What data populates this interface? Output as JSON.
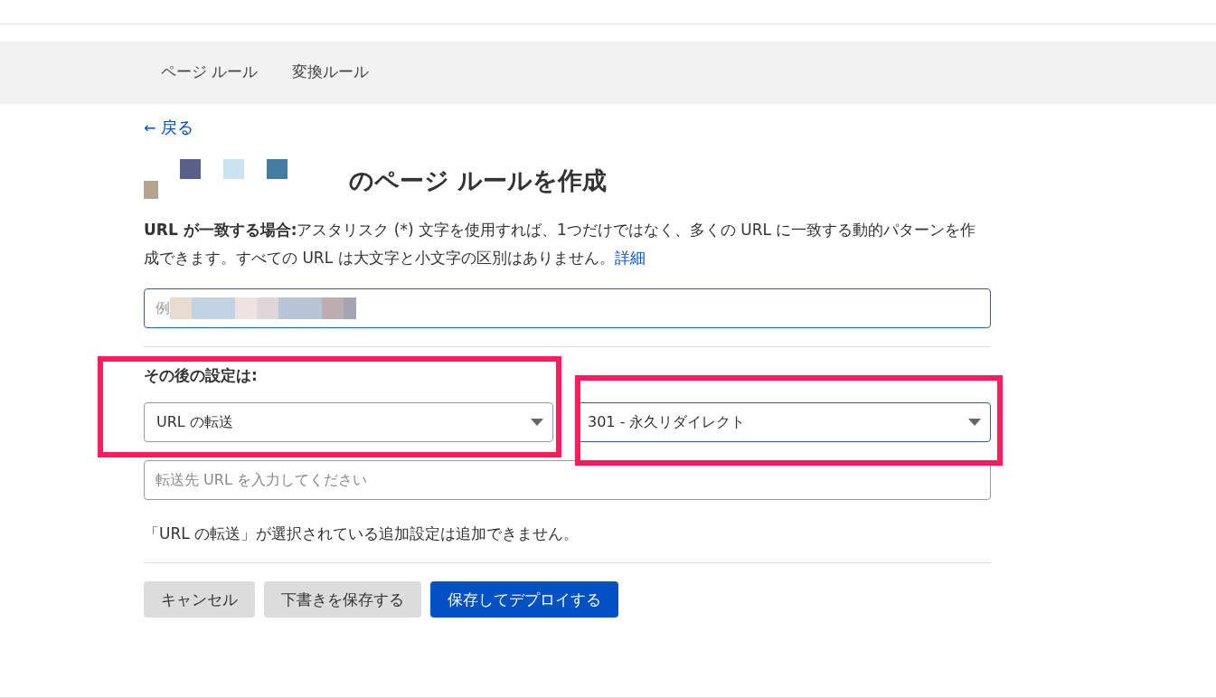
{
  "nav": {
    "tabs": [
      {
        "label": "ページ ルール",
        "selected": false
      },
      {
        "label": "変換ルール",
        "selected": false
      }
    ]
  },
  "back_link": {
    "arrow": "←",
    "label": "戻る"
  },
  "title": "のページ ルールを作成",
  "description": {
    "text": "**URL が一致する場合:**アスタリスク (*) 文字を使用すれば、1つだけではなく、多くの URL に一致する動的パターンを作成できます。すべての URL は大文字と小文字の区別はありません。",
    "link": "詳細"
  },
  "url_field": {
    "placeholder": "例"
  },
  "settings": {
    "label": "その後の設定は:",
    "setting_select": {
      "value": "URL の転送",
      "focused": false
    },
    "status_select": {
      "value": "301 - 永久リダイレクト",
      "focused": true
    },
    "destination_field": {
      "placeholder": "転送先 URL を入力してください"
    },
    "note": "「URL の転送」が選択されている追加設定は追加できません。"
  },
  "buttons": [
    {
      "label": "キャンセル",
      "kind": "secondary"
    },
    {
      "label": "下書きを保存する",
      "kind": "secondary"
    },
    {
      "label": "保存してデプロイする",
      "kind": "primary"
    }
  ]
}
